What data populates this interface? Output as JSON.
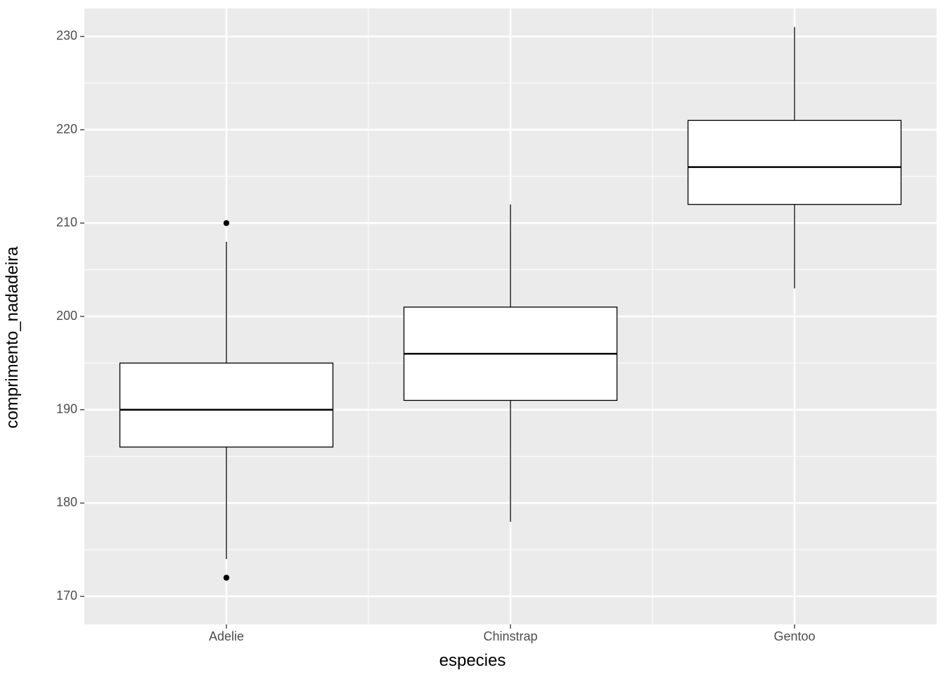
{
  "chart_data": {
    "type": "boxplot",
    "xlabel": "especies",
    "ylabel": "comprimento_nadadeira",
    "ylim": [
      167,
      233
    ],
    "y_ticks": [
      170,
      180,
      190,
      200,
      210,
      220,
      230
    ],
    "categories": [
      "Adelie",
      "Chinstrap",
      "Gentoo"
    ],
    "boxes": [
      {
        "name": "Adelie",
        "whisker_low": 174,
        "q1": 186,
        "median": 190,
        "q3": 195,
        "whisker_high": 208,
        "outliers": [
          172,
          210
        ]
      },
      {
        "name": "Chinstrap",
        "whisker_low": 178,
        "q1": 191,
        "median": 196,
        "q3": 201,
        "whisker_high": 212,
        "outliers": []
      },
      {
        "name": "Gentoo",
        "whisker_low": 203,
        "q1": 212,
        "median": 216,
        "q3": 221,
        "whisker_high": 231,
        "outliers": []
      }
    ]
  }
}
